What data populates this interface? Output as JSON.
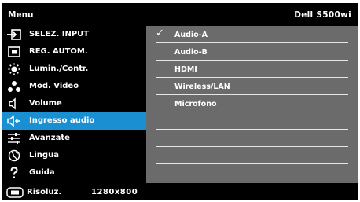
{
  "header": {
    "title": "Menu",
    "model": "Dell S500wi"
  },
  "menu": {
    "items": [
      {
        "label": "SELEZ. INPUT",
        "icon": "input-source-icon"
      },
      {
        "label": "REG. AUTOM.",
        "icon": "auto-adjust-icon"
      },
      {
        "label": "Lumin./Contr.",
        "icon": "brightness-icon"
      },
      {
        "label": "Mod. Video",
        "icon": "video-mode-icon"
      },
      {
        "label": "Volume",
        "icon": "speaker-icon"
      },
      {
        "label": "Ingresso audio",
        "icon": "audio-input-icon",
        "selected": true
      },
      {
        "label": "Avanzate",
        "icon": "advanced-sliders-icon"
      },
      {
        "label": "Lingua",
        "icon": "language-icon"
      },
      {
        "label": "Guida",
        "icon": "help-icon"
      }
    ]
  },
  "submenu": {
    "options": [
      {
        "label": "Audio-A",
        "checked": true
      },
      {
        "label": "Audio-B"
      },
      {
        "label": "HDMI"
      },
      {
        "label": "Wireless/LAN"
      },
      {
        "label": "Microfono"
      },
      {
        "label": ""
      },
      {
        "label": ""
      },
      {
        "label": ""
      },
      {
        "label": ""
      }
    ]
  },
  "footer": {
    "label": "Risoluz.",
    "value": "1280x800",
    "icon": "monitor-icon"
  },
  "colors": {
    "highlight": "#1a90d3",
    "panel": "#6b6b6b",
    "background": "#000000"
  }
}
